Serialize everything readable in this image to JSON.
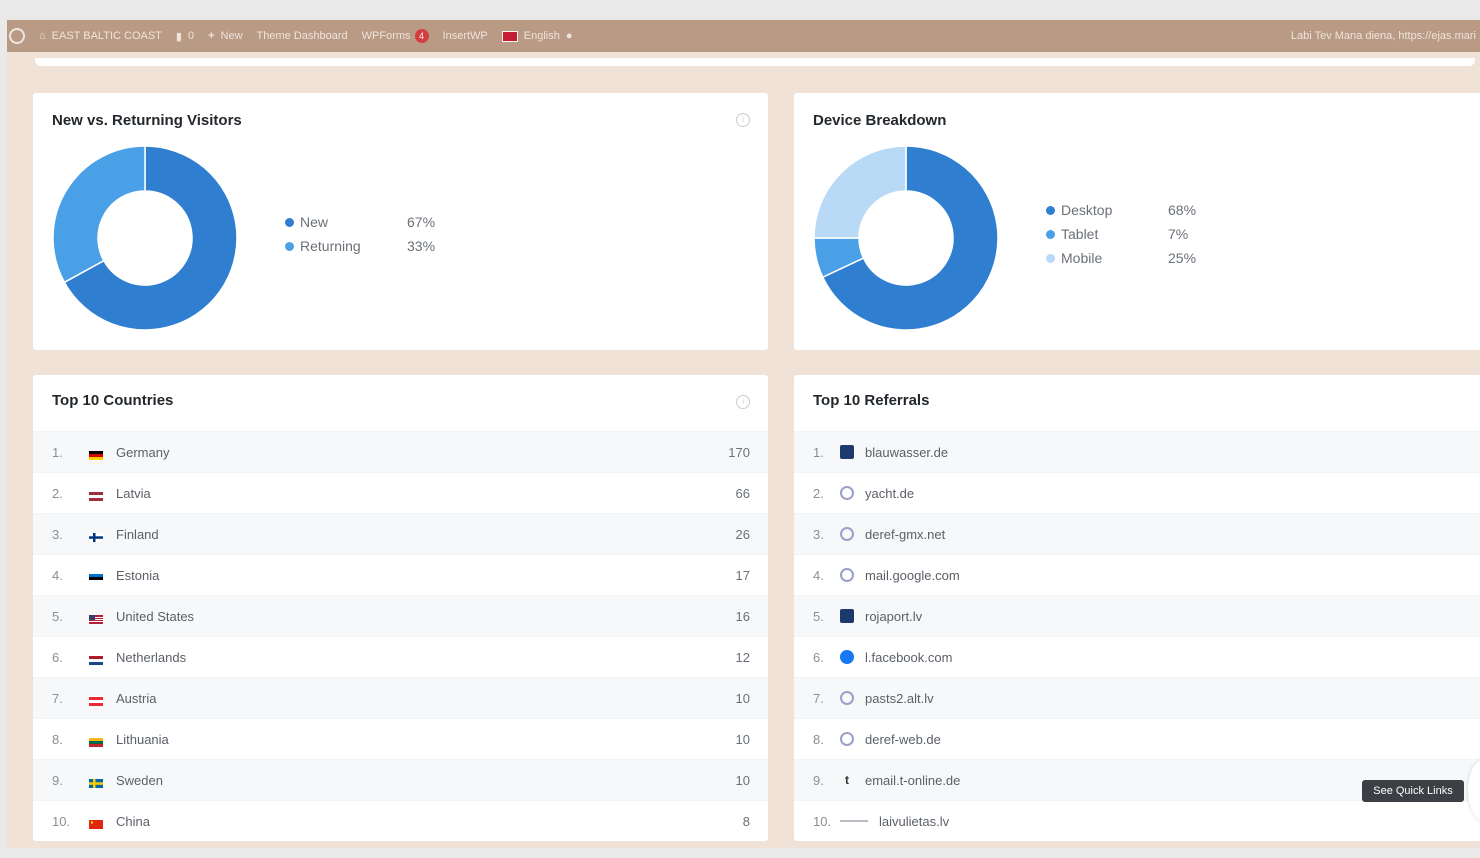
{
  "adminbar": {
    "site_name": "EAST BALTIC COAST",
    "comments_count": "0",
    "new_label": "New",
    "theme_dashboard": "Theme Dashboard",
    "wpforms_label": "WPForms",
    "wpforms_badge": "4",
    "insights_label": "InsertWP",
    "language_label": "English",
    "greeting": "Labi Tev Mana diena, https://ejas.mari"
  },
  "new_vs_returning": {
    "title": "New vs. Returning Visitors",
    "items": [
      {
        "label": "New",
        "pct": "67%",
        "value": 67,
        "color": "#2f7ed0"
      },
      {
        "label": "Returning",
        "pct": "33%",
        "value": 33,
        "color": "#4aa0e6"
      }
    ]
  },
  "device_breakdown": {
    "title": "Device Breakdown",
    "items": [
      {
        "label": "Desktop",
        "pct": "68%",
        "value": 68,
        "color": "#2f7ed0"
      },
      {
        "label": "Tablet",
        "pct": "7%",
        "value": 7,
        "color": "#4aa0e6"
      },
      {
        "label": "Mobile",
        "pct": "25%",
        "value": 25,
        "color": "#b8daf6"
      }
    ]
  },
  "countries": {
    "title": "Top 10 Countries",
    "rows": [
      {
        "num": "1.",
        "name": "Germany",
        "value": "170",
        "flag": "germany"
      },
      {
        "num": "2.",
        "name": "Latvia",
        "value": "66",
        "flag": "latvia"
      },
      {
        "num": "3.",
        "name": "Finland",
        "value": "26",
        "flag": "finland"
      },
      {
        "num": "4.",
        "name": "Estonia",
        "value": "17",
        "flag": "estonia"
      },
      {
        "num": "5.",
        "name": "United States",
        "value": "16",
        "flag": "usa"
      },
      {
        "num": "6.",
        "name": "Netherlands",
        "value": "12",
        "flag": "netherlands"
      },
      {
        "num": "7.",
        "name": "Austria",
        "value": "10",
        "flag": "austria"
      },
      {
        "num": "8.",
        "name": "Lithuania",
        "value": "10",
        "flag": "lithuania"
      },
      {
        "num": "9.",
        "name": "Sweden",
        "value": "10",
        "flag": "sweden"
      },
      {
        "num": "10.",
        "name": "China",
        "value": "8",
        "flag": "china"
      }
    ]
  },
  "referrals": {
    "title": "Top 10 Referrals",
    "rows": [
      {
        "num": "1.",
        "name": "blauwasser.de",
        "icon": "site-favicon"
      },
      {
        "num": "2.",
        "name": "yacht.de",
        "icon": "globe-icon"
      },
      {
        "num": "3.",
        "name": "deref-gmx.net",
        "icon": "globe-icon"
      },
      {
        "num": "4.",
        "name": "mail.google.com",
        "icon": "globe-icon"
      },
      {
        "num": "5.",
        "name": "rojaport.lv",
        "icon": "site-favicon"
      },
      {
        "num": "6.",
        "name": "l.facebook.com",
        "icon": "facebook-icon"
      },
      {
        "num": "7.",
        "name": "pasts2.alt.lv",
        "icon": "globe-icon"
      },
      {
        "num": "8.",
        "name": "deref-web.de",
        "icon": "globe-icon"
      },
      {
        "num": "9.",
        "name": "email.t-online.de",
        "icon": "t-online-icon"
      },
      {
        "num": "10.",
        "name": "laivulietas.lv",
        "icon": "dash-icon"
      }
    ]
  },
  "quick_links": "See Quick Links"
}
